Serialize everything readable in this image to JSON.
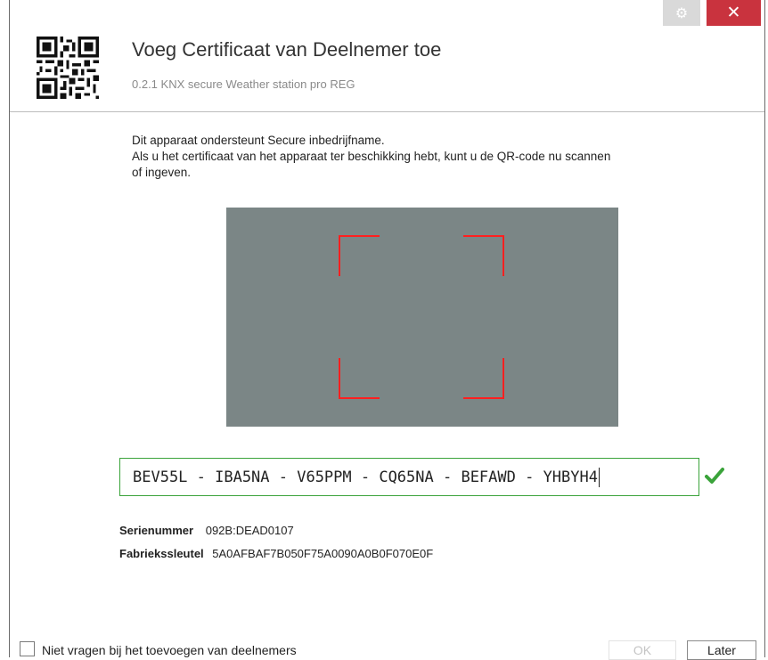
{
  "window": {
    "settings_icon": "gear-icon",
    "close_icon": "close-icon",
    "close_glyph": "✕",
    "settings_glyph": "⚙"
  },
  "header": {
    "title": "Voeg Certificaat van Deelnemer toe",
    "subtitle": "0.2.1 KNX secure Weather station pro REG",
    "icon": "qr-code-icon"
  },
  "description": {
    "line1": "Dit apparaat ondersteunt Secure inbedrijfname.",
    "line2": "Als u het certificaat van het apparaat ter beschikking hebt, kunt u de QR-code nu scannen",
    "line3": "of ingeven."
  },
  "key_input": {
    "value": "BEV55L - IBA5NA - V65PPM - CQ65NA - BEFAWD - YHBYH4",
    "valid_icon": "checkmark-icon"
  },
  "info": {
    "serial_label": "Serienummer",
    "serial_value": "092B:DEAD0107",
    "factory_key_label": "Fabriekssleutel",
    "factory_key_value": "5A0AFBAF7B050F75A0090A0B0F070E0F"
  },
  "footer": {
    "checkbox_label": "Niet vragen bij het toevoegen van deelnemers",
    "checkbox_checked": false,
    "ok_label": "OK",
    "later_label": "Later"
  },
  "colors": {
    "close_button": "#c9333e",
    "scanner_bg": "#7b8686",
    "scanner_corners": "#ff2020",
    "valid_border": "#3aa33a",
    "check": "#3aa33a"
  }
}
